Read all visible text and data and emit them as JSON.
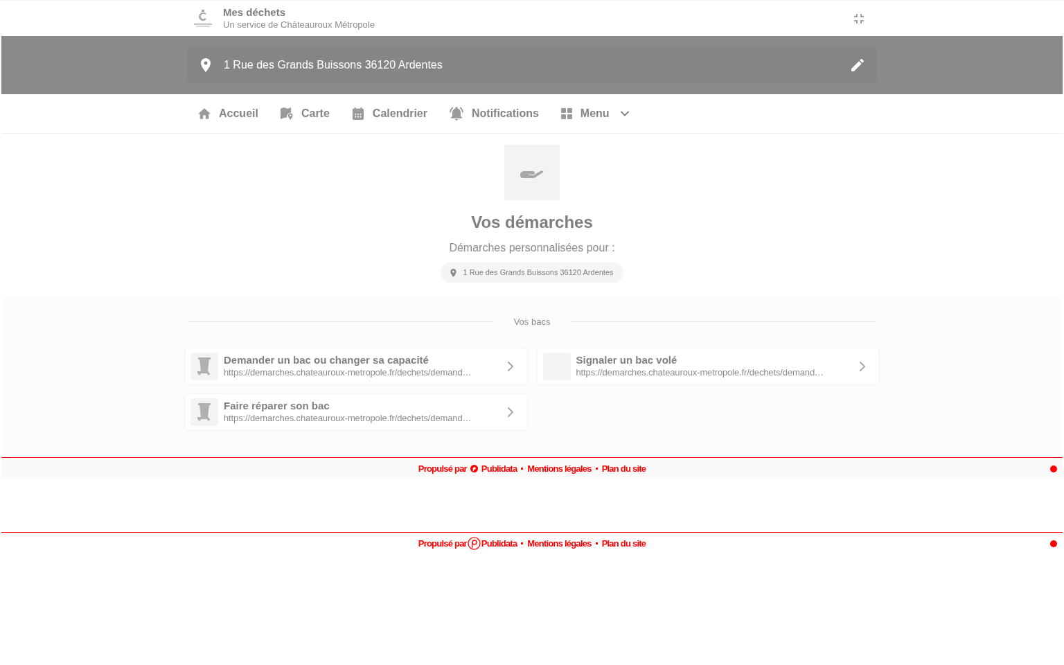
{
  "header": {
    "title": "Mes déchets",
    "subtitle": "Un service de Châteauroux Métropole"
  },
  "address_bar": {
    "value": "1 Rue des Grands Buissons 36120 Ardentes"
  },
  "nav": [
    {
      "kind": "home",
      "label": "Accueil"
    },
    {
      "kind": "map",
      "label": "Carte"
    },
    {
      "kind": "calendar",
      "label": "Calendrier"
    },
    {
      "kind": "bell",
      "label": "Notifications"
    },
    {
      "kind": "menu",
      "label": "Menu"
    }
  ],
  "procedures": {
    "title": "Vos démarches",
    "subtitle": "Démarches personnalisées pour :",
    "address": "1 Rue des Grands Buissons 36120 Ardentes"
  },
  "bins_section": {
    "heading": "Vos bacs",
    "cards": [
      {
        "kind": "bin",
        "title": "Demander un bac ou changer sa capacité",
        "url": "https://demarches.chateauroux-metropole.fr/dechets/demand…"
      },
      {
        "kind": "blank",
        "title": "Signaler un bac volé",
        "url": "https://demarches.chateauroux-metropole.fr/dechets/demand…"
      },
      {
        "kind": "bin",
        "title": "Faire réparer son bac",
        "url": "https://demarches.chateauroux-metropole.fr/dechets/demand…"
      }
    ]
  },
  "footers": [
    {
      "kind": "banded",
      "powered_by": "Propulsé par",
      "brand": "Publidata",
      "links": [
        "Mentions légales",
        "Plan du site"
      ]
    },
    {
      "kind": "plain",
      "powered_by": "Propulsé par",
      "brand": "Publidata",
      "links": [
        "Mentions légales",
        "Plan du site"
      ]
    }
  ]
}
